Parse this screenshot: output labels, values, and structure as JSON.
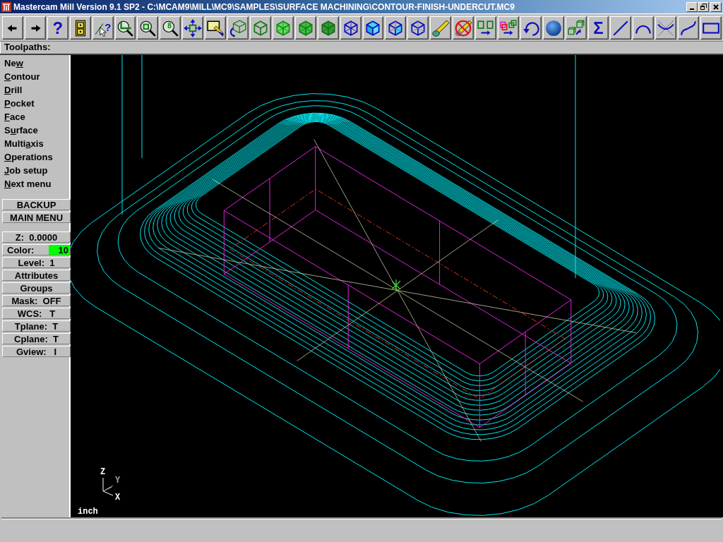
{
  "window": {
    "title": "Mastercam Mill Version 9.1 SP2 - C:\\MCAM9\\MILL\\MC9\\SAMPLES\\SURFACE MACHINING\\CONTOUR-FINISH-UNDERCUT.MC9"
  },
  "toolbar": [
    {
      "kind": "arrow-left"
    },
    {
      "kind": "arrow-right"
    },
    {
      "kind": "text",
      "label": "?"
    },
    {
      "kind": "cabinet"
    },
    {
      "kind": "query",
      "label": "?"
    },
    {
      "kind": "zoom-window"
    },
    {
      "kind": "zoom-box"
    },
    {
      "kind": "zoom-label",
      "label": "8"
    },
    {
      "kind": "pan"
    },
    {
      "kind": "paint"
    },
    {
      "kind": "rotate-cube"
    },
    {
      "kind": "cube-green-wire"
    },
    {
      "kind": "cube-green-light"
    },
    {
      "kind": "cube-green-mid"
    },
    {
      "kind": "cube-green-dark"
    },
    {
      "kind": "cube-blue-wire"
    },
    {
      "kind": "cube-blue-shaded"
    },
    {
      "kind": "cube-blue-front"
    },
    {
      "kind": "cube-blue-outline"
    },
    {
      "kind": "pencil"
    },
    {
      "kind": "no-pencil"
    },
    {
      "kind": "translate"
    },
    {
      "kind": "copy"
    },
    {
      "kind": "undo"
    },
    {
      "kind": "sphere"
    },
    {
      "kind": "boxes"
    },
    {
      "kind": "text",
      "label": "Σ"
    },
    {
      "kind": "line"
    },
    {
      "kind": "arc"
    },
    {
      "kind": "fillet"
    },
    {
      "kind": "spline"
    },
    {
      "kind": "rectangle"
    }
  ],
  "menu": {
    "title": "Toolpaths:",
    "items": [
      {
        "label_before_hotkey": "Ne",
        "hotkey": "w"
      },
      {
        "hotkey": "C",
        "label_after_hotkey": "ontour"
      },
      {
        "hotkey": "D",
        "label_after_hotkey": "rill"
      },
      {
        "hotkey": "P",
        "label_after_hotkey": "ocket"
      },
      {
        "hotkey": "F",
        "label_after_hotkey": "ace"
      },
      {
        "label_before_hotkey": "S",
        "hotkey": "u",
        "label_after_hotkey": "rface"
      },
      {
        "label_before_hotkey": "Multi",
        "hotkey": "a",
        "label_after_hotkey": "xis"
      },
      {
        "hotkey": "O",
        "label_after_hotkey": "perations"
      },
      {
        "hotkey": "J",
        "label_after_hotkey": "ob setup"
      },
      {
        "hotkey": "N",
        "label_after_hotkey": "ext menu"
      }
    ]
  },
  "nav_buttons": [
    "BACKUP",
    "MAIN MENU"
  ],
  "settings": [
    {
      "kind": "text",
      "label": "Z:  0.0000"
    },
    {
      "kind": "swatch",
      "label": "Color:",
      "value": "10",
      "color": "#00ff00"
    },
    {
      "kind": "text",
      "label": "Level:  1"
    },
    {
      "kind": "text",
      "label": "Attributes"
    },
    {
      "kind": "text",
      "label": "Groups"
    },
    {
      "kind": "text",
      "label": "Mask:  OFF"
    },
    {
      "kind": "text",
      "label": "WCS:   T"
    },
    {
      "kind": "text",
      "label": "Tplane:  T"
    },
    {
      "kind": "text",
      "label": "Cplane:  T"
    },
    {
      "kind": "text",
      "label": "Gview:   I"
    }
  ],
  "viewport": {
    "axes": {
      "z": "Z",
      "y": "Y",
      "x": "X"
    },
    "units": "inch"
  }
}
